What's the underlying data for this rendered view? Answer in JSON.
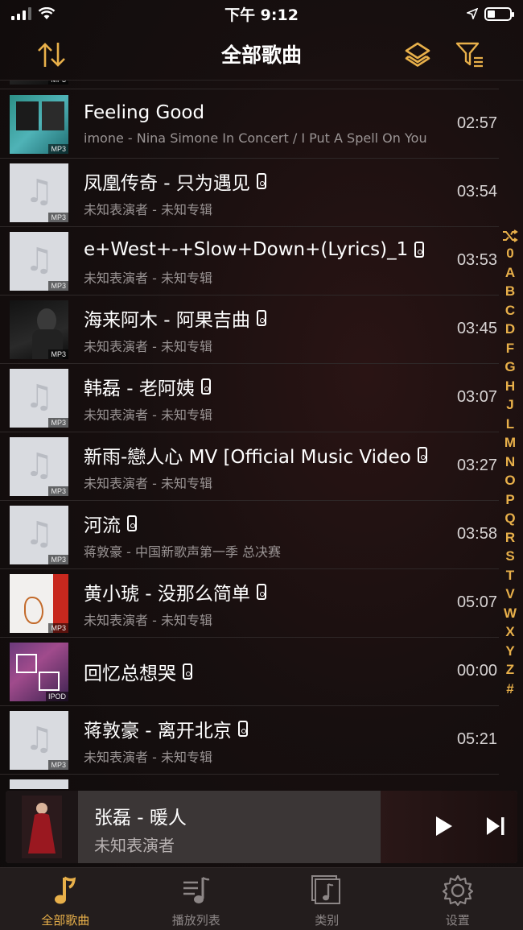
{
  "status": {
    "time": "下午 9:12"
  },
  "nav": {
    "title": "全部歌曲"
  },
  "songs": [
    {
      "title": "Feeling Good",
      "subtitle": "imone - Nina Simone In Concert / I Put A Spell On You",
      "duration": "02:57",
      "badge": "MP3",
      "art": "album-art-nina-simone",
      "ipod": false
    },
    {
      "title": "凤凰传奇 - 只为遇见",
      "subtitle": "未知表演者 - 未知专辑",
      "duration": "03:54",
      "badge": "MP3",
      "art": "placeholder",
      "ipod": true
    },
    {
      "title": "e+West+-+Slow+Down+(Lyrics)_1",
      "subtitle": "未知表演者 - 未知专辑",
      "duration": "03:53",
      "badge": "MP3",
      "art": "placeholder",
      "ipod": true
    },
    {
      "title": "海来阿木 - 阿果吉曲",
      "subtitle": "未知表演者 - 未知专辑",
      "duration": "03:45",
      "badge": "MP3",
      "art": "album-art-dark-portrait",
      "ipod": true
    },
    {
      "title": "韩磊 - 老阿姨",
      "subtitle": "未知表演者 - 未知专辑",
      "duration": "03:07",
      "badge": "MP3",
      "art": "placeholder",
      "ipod": true
    },
    {
      "title": "新雨-戀人心 MV [Official Music Video",
      "subtitle": "未知表演者 - 未知专辑",
      "duration": "03:27",
      "badge": "MP3",
      "art": "placeholder",
      "ipod": true
    },
    {
      "title": "河流",
      "subtitle": "蒋敦豪 - 中国新歌声第一季 总决赛",
      "duration": "03:58",
      "badge": "MP3",
      "art": "placeholder",
      "ipod": true
    },
    {
      "title": "黄小琥 - 没那么简单",
      "subtitle": "未知表演者 - 未知专辑",
      "duration": "05:07",
      "badge": "MP3",
      "art": "album-art-red-figure",
      "ipod": true
    },
    {
      "title": "回忆总想哭",
      "subtitle": "",
      "duration": "00:00",
      "badge": "IPOD",
      "art": "album-art-purple",
      "ipod": true
    },
    {
      "title": "蒋敦豪 - 离开北京",
      "subtitle": "未知表演者 - 未知专辑",
      "duration": "05:21",
      "badge": "MP3",
      "art": "placeholder",
      "ipod": true
    }
  ],
  "index_letters": [
    "0",
    "A",
    "B",
    "C",
    "D",
    "F",
    "G",
    "H",
    "J",
    "L",
    "M",
    "N",
    "O",
    "P",
    "Q",
    "R",
    "S",
    "T",
    "V",
    "W",
    "X",
    "Y",
    "Z",
    "#"
  ],
  "mini_player": {
    "title": "张磊 - 暖人",
    "artist": "未知表演者"
  },
  "tabs": [
    {
      "label": "全部歌曲",
      "icon": "music-note-icon",
      "active": true
    },
    {
      "label": "播放列表",
      "icon": "playlist-icon",
      "active": false
    },
    {
      "label": "类别",
      "icon": "category-icon",
      "active": false
    },
    {
      "label": "设置",
      "icon": "gear-icon",
      "active": false
    }
  ],
  "colors": {
    "accent": "#e8b04a",
    "background": "#141010",
    "row_divider": "#2e2828"
  }
}
